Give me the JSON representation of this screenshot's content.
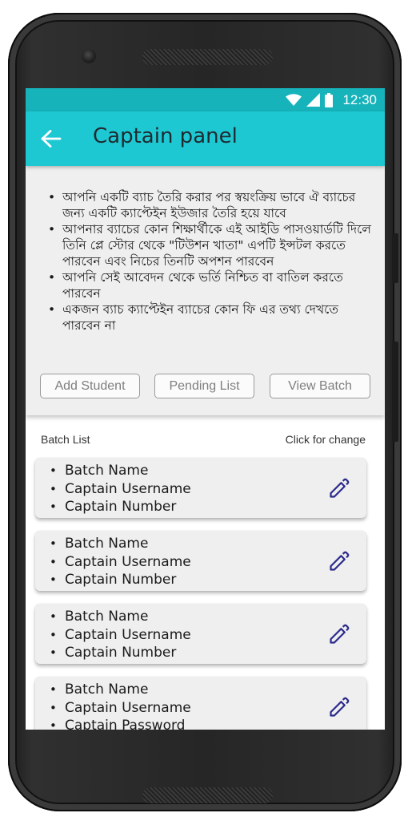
{
  "status_bar": {
    "time": "12:30",
    "icons": [
      "wifi-icon",
      "signal-icon",
      "battery-icon"
    ]
  },
  "app_bar": {
    "title": "Captain panel",
    "back_icon": "arrow-back-icon"
  },
  "info": {
    "bullets": [
      "আপনি একটি ব্যাচ তৈরি করার পর স্বয়ংক্রিয় ভাবে ঐ ব্যাচের জন্য একটি ক্যাপ্টেইন ইউজার তৈরি হয়ে যাবে",
      "আপনার ব্যাচের কোন শিক্ষার্থীকে এই আইডি পাসওয়ার্ডটি দিলে তিনি প্লে স্টোর থেকে \"টিউশন খাতা\" এপটি ইন্সটল করতে পারবেন এবং  নিচের তিনটি অপশন পারবেন",
      "আপনি সেই আবেদন থেকে ভর্তি নিশ্চিত বা বাতিল করতে পারবেন",
      "একজন ব্যাচ ক্যাপ্টেইন ব্যাচের কোন ফি এর তথ্য দেখতে পারবেন না"
    ]
  },
  "actions": {
    "add_student": "Add Student",
    "pending_list": "Pending List",
    "view_batch": "View Batch"
  },
  "list": {
    "title": "Batch List",
    "hint": "Click for change",
    "cards": [
      {
        "lines": [
          "Batch Name",
          "Captain Username",
          "Captain Number"
        ]
      },
      {
        "lines": [
          "Batch Name",
          "Captain Username",
          "Captain Number"
        ]
      },
      {
        "lines": [
          "Batch Name",
          "Captain Username",
          "Captain Number"
        ]
      },
      {
        "lines": [
          "Batch Name",
          "Captain Username",
          "Captain Password"
        ]
      }
    ],
    "edit_icon": "pencil-icon"
  },
  "colors": {
    "status_bar": "#16b3bb",
    "app_bar": "#1ec8d3",
    "panel_bg": "#efefef",
    "edit_icon": "#2b2a8c"
  }
}
